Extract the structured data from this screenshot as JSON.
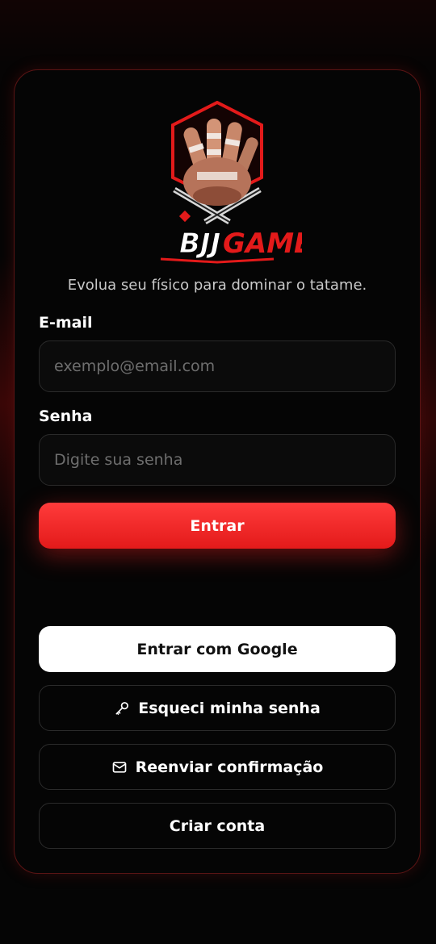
{
  "brand": {
    "name_part1": "BJJ",
    "name_part2": "GAME",
    "accent_color": "#e31a1a",
    "logo_icon": "taped-fist-shield-icon"
  },
  "login": {
    "tagline": "Evolua seu físico para dominar o tatame.",
    "email": {
      "label": "E-mail",
      "placeholder": "exemplo@email.com",
      "value": ""
    },
    "password": {
      "label": "Senha",
      "placeholder": "Digite sua senha",
      "value": ""
    },
    "submit_label": "Entrar",
    "google_label": "Entrar com Google",
    "forgot": {
      "label": "Esqueci minha senha",
      "icon": "key-icon"
    },
    "resend": {
      "label": "Reenviar confirmação",
      "icon": "mail-icon"
    },
    "signup_label": "Criar conta"
  }
}
